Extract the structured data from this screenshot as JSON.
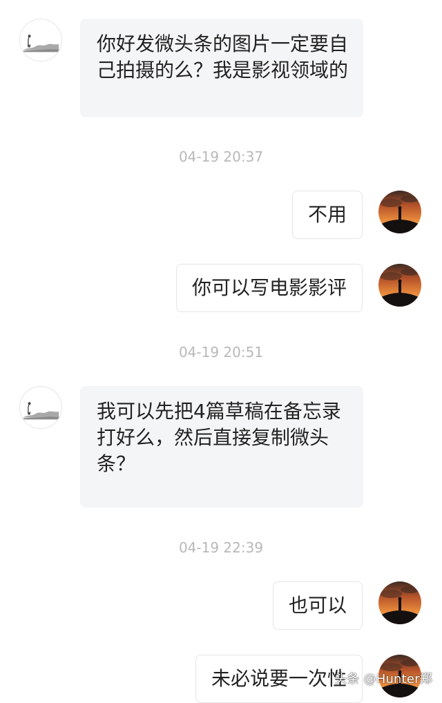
{
  "messages": [
    {
      "sender": "other",
      "text": "你好发微头条的图片一定要自己拍摄的么？我是影视领域的"
    },
    {
      "timestamp": "04-19 20:37"
    },
    {
      "sender": "self",
      "text": "不用"
    },
    {
      "sender": "self",
      "text": "你可以写电影影评"
    },
    {
      "timestamp": "04-19 20:51"
    },
    {
      "sender": "other",
      "text": "我可以先把4篇草稿在备忘录打好么，然后直接复制微头条？"
    },
    {
      "timestamp": "04-19 22:39"
    },
    {
      "sender": "self",
      "text": "也可以"
    },
    {
      "sender": "self",
      "text": "未必说要一次性"
    }
  ],
  "avatars": {
    "other": "ink-landscape-avatar",
    "self": "sunset-silhouette-avatar"
  },
  "watermark": "头条 @Hunter郑",
  "colors": {
    "incoming_bubble": "#f4f5f6",
    "outgoing_bubble": "#ffffff",
    "timestamp": "#b8b8b8",
    "text": "#222222"
  }
}
